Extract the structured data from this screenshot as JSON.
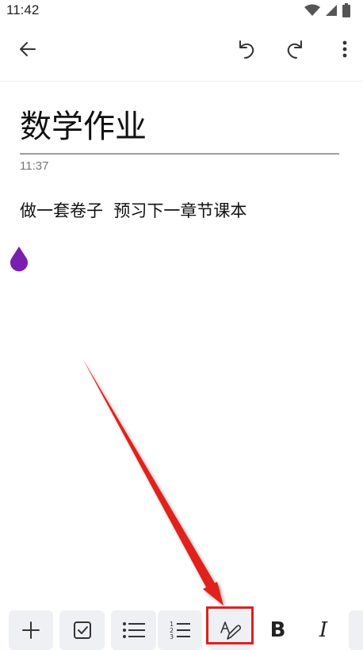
{
  "status_bar": {
    "time": "11:42",
    "icons": [
      "wifi-icon",
      "signal-icon",
      "battery-icon"
    ]
  },
  "app_bar": {
    "back_icon": "back-arrow-icon",
    "undo_icon": "undo-icon",
    "redo_icon": "redo-icon",
    "more_icon": "more-vertical-icon"
  },
  "note": {
    "title": "数学作业",
    "time": "11:37",
    "body": "做一套卷子  预习下一章节课本",
    "handle_color": "#7a1fb0"
  },
  "toolbar": {
    "buttons": [
      "plus-icon",
      "checkbox-icon",
      "bullet-list-icon",
      "numbered-list-icon",
      "text-style-pen-icon",
      "bold-icon",
      "italic-icon"
    ],
    "bold_label": "B",
    "italic_label": "I",
    "highlighted": "text-style-pen-icon"
  },
  "annotation": {
    "arrow_color": "#e0201c",
    "box_color": "#e0201c"
  }
}
